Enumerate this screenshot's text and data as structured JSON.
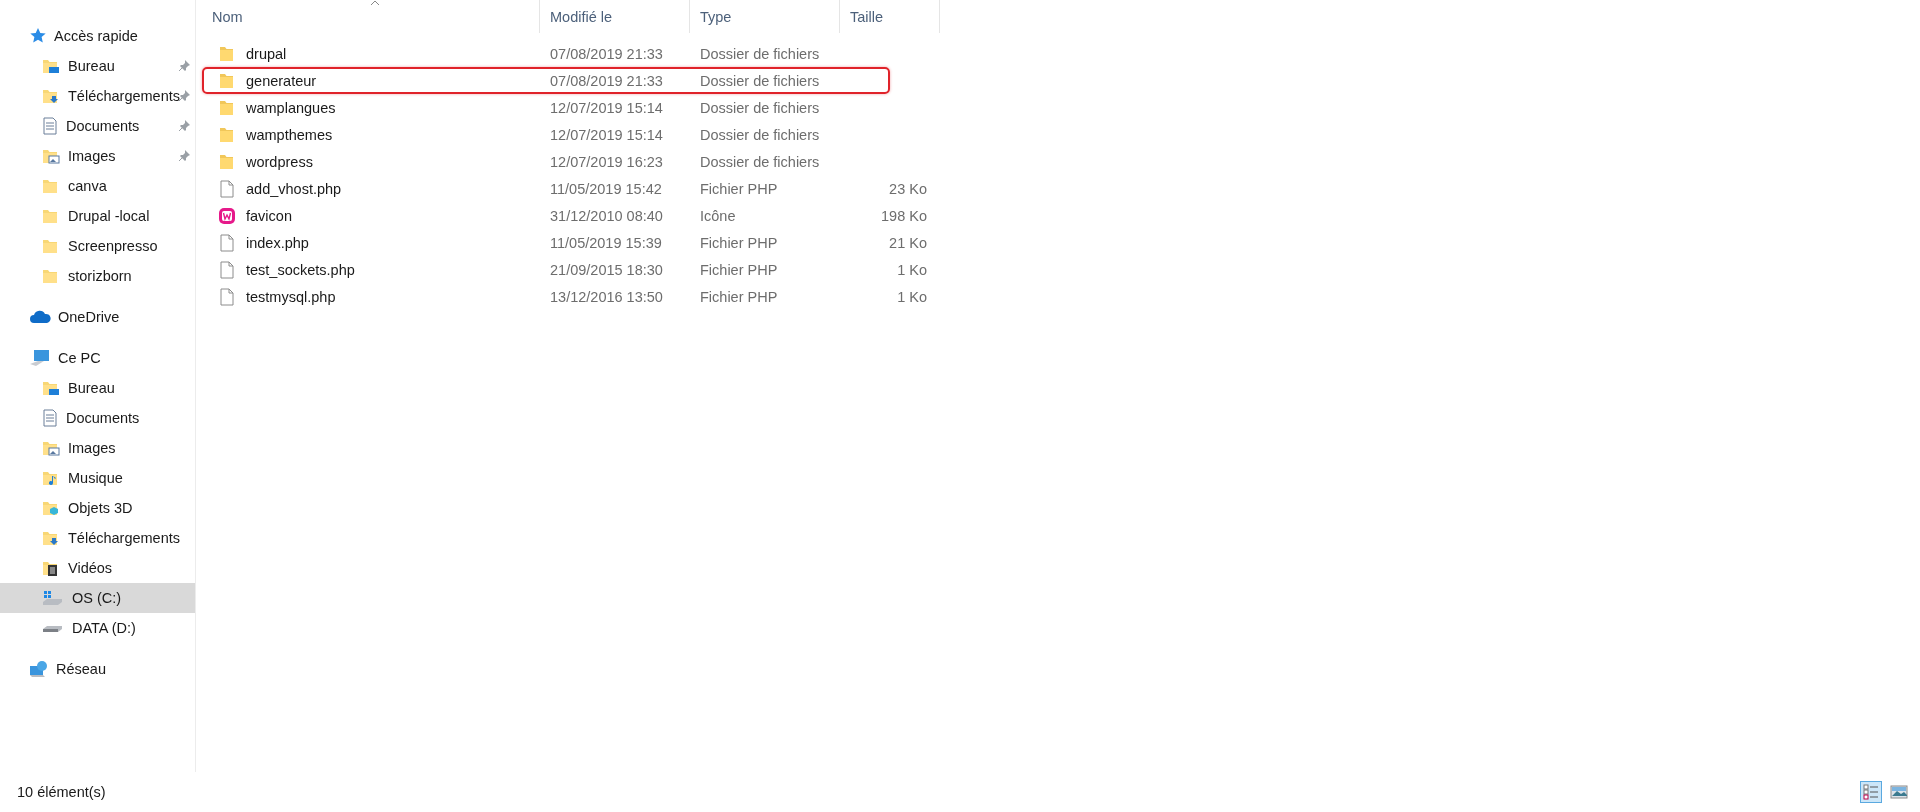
{
  "sidebar": {
    "groups": [
      {
        "label": "Accès rapide",
        "kind": "quickaccess",
        "selected": false,
        "children": [
          {
            "label": "Bureau",
            "kind": "desktop",
            "pinned": true,
            "selected": false
          },
          {
            "label": "Téléchargements",
            "kind": "downloads",
            "pinned": true,
            "selected": false
          },
          {
            "label": "Documents",
            "kind": "documents",
            "pinned": true,
            "selected": false
          },
          {
            "label": "Images",
            "kind": "pictures",
            "pinned": true,
            "selected": false
          },
          {
            "label": "canva",
            "kind": "folder",
            "pinned": false,
            "selected": false
          },
          {
            "label": "Drupal -local",
            "kind": "folder",
            "pinned": false,
            "selected": false
          },
          {
            "label": "Screenpresso",
            "kind": "folder",
            "pinned": false,
            "selected": false
          },
          {
            "label": "storizborn",
            "kind": "folder",
            "pinned": false,
            "selected": false
          }
        ]
      },
      {
        "label": "OneDrive",
        "kind": "cloud",
        "selected": false
      },
      {
        "label": "Ce PC",
        "kind": "pc",
        "selected": false,
        "children": [
          {
            "label": "Bureau",
            "kind": "desktop",
            "pinned": false,
            "selected": false
          },
          {
            "label": "Documents",
            "kind": "documents",
            "pinned": false,
            "selected": false
          },
          {
            "label": "Images",
            "kind": "pictures",
            "pinned": false,
            "selected": false
          },
          {
            "label": "Musique",
            "kind": "music",
            "pinned": false,
            "selected": false
          },
          {
            "label": "Objets 3D",
            "kind": "objects",
            "pinned": false,
            "selected": false
          },
          {
            "label": "Téléchargements",
            "kind": "downloads",
            "pinned": false,
            "selected": false
          },
          {
            "label": "Vidéos",
            "kind": "videos",
            "pinned": false,
            "selected": false
          },
          {
            "label": "OS (C:)",
            "kind": "systemdrive",
            "pinned": false,
            "selected": true
          },
          {
            "label": "DATA (D:)",
            "kind": "drive",
            "pinned": false,
            "selected": false
          }
        ]
      },
      {
        "label": "Réseau",
        "kind": "network",
        "selected": false
      }
    ]
  },
  "table": {
    "columns": [
      {
        "label": "Nom",
        "sorted": true
      },
      {
        "label": "Modifié le",
        "sorted": false
      },
      {
        "label": "Type",
        "sorted": false
      },
      {
        "label": "Taille",
        "sorted": false
      }
    ],
    "rows": [
      {
        "kind": "folder",
        "name": "drupal",
        "modified": "07/08/2019 21:33",
        "type": "Dossier de fichiers",
        "outlined": false
      },
      {
        "kind": "folder",
        "name": "generateur",
        "modified": "07/08/2019 21:33",
        "type": "Dossier de fichiers",
        "outlined": true
      },
      {
        "kind": "folder",
        "name": "wamplangues",
        "modified": "12/07/2019 15:14",
        "type": "Dossier de fichiers",
        "outlined": false
      },
      {
        "kind": "folder",
        "name": "wampthemes",
        "modified": "12/07/2019 15:14",
        "type": "Dossier de fichiers",
        "outlined": false
      },
      {
        "kind": "folder",
        "name": "wordpress",
        "modified": "12/07/2019 16:23",
        "type": "Dossier de fichiers",
        "outlined": false
      },
      {
        "kind": "file",
        "name": "add_vhost.php",
        "modified": "11/05/2019 15:42",
        "type": "Fichier PHP",
        "size": "23 Ko",
        "outlined": false
      },
      {
        "kind": "appicon",
        "name": "favicon",
        "modified": "31/12/2010 08:40",
        "type": "Icône",
        "size": "198 Ko",
        "outlined": false
      },
      {
        "kind": "file",
        "name": "index.php",
        "modified": "11/05/2019 15:39",
        "type": "Fichier PHP",
        "size": "21 Ko",
        "outlined": false
      },
      {
        "kind": "file",
        "name": "test_sockets.php",
        "modified": "21/09/2015 18:30",
        "type": "Fichier PHP",
        "size": "1 Ko",
        "outlined": false
      },
      {
        "kind": "file",
        "name": "testmysql.php",
        "modified": "13/12/2016 13:50",
        "type": "Fichier PHP",
        "size": "1 Ko",
        "outlined": false
      }
    ]
  },
  "status_bar": {
    "count": "10 élément(s)",
    "view_buttons": [
      {
        "kind": "details",
        "selected": true
      },
      {
        "kind": "tiles",
        "selected": false
      }
    ]
  }
}
